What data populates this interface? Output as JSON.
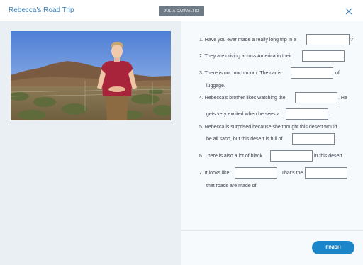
{
  "header": {
    "title": "Rebecca's Road Trip",
    "user_name": "JULIA CARVALHO"
  },
  "questions": {
    "q1_text": "1.  Have you ever made a really long trip in a",
    "q1_after": "?",
    "q2_text": "2.  They are driving across America in their",
    "q3_text": "3.  There is not much room. The car is",
    "q3_after": "of",
    "q3_cont": "luggage.",
    "q4_text": "4.  Rebecca's brother likes watching the",
    "q4_after": ". He",
    "q4_cont": "gets very excited when he sees a",
    "q4_end": ".",
    "q5_text": "5.  Rebecca is surprised because she thought this desert would",
    "q5_cont": "be all sand, but this desert is full of",
    "q5_end": ".",
    "q6_text": "6.  There is also a lot of black",
    "q6_after": "in this desert.",
    "q7_text": "7.  It looks like",
    "q7_after": ". That's the",
    "q7_cont": "that roads are made of."
  },
  "footer": {
    "finish_label": "FINISH"
  },
  "colors": {
    "accent": "#1a85c9",
    "title": "#3a7fb9",
    "badge": "#6e7b86"
  }
}
